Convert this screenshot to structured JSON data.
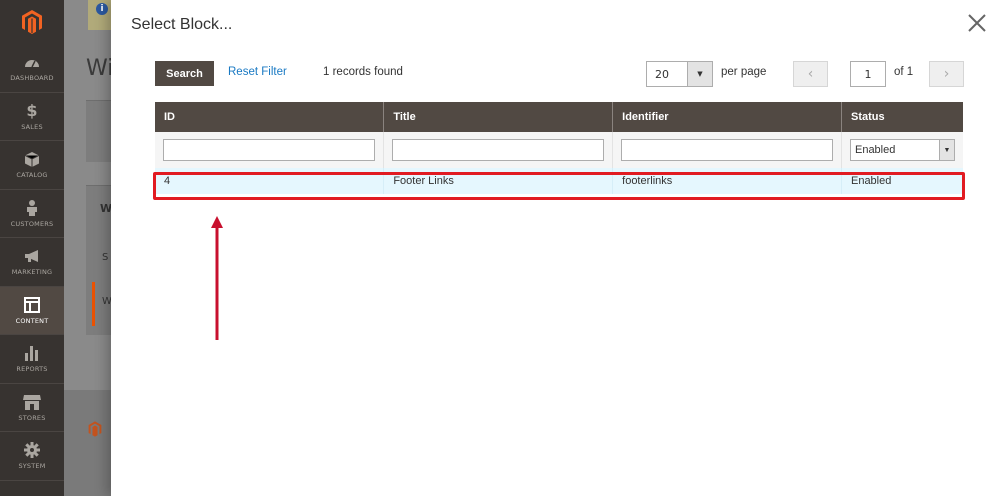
{
  "sidebar": {
    "items": [
      {
        "label": "Dashboard",
        "icon": "dashboard-icon"
      },
      {
        "label": "Sales",
        "icon": "dollar-icon"
      },
      {
        "label": "Catalog",
        "icon": "cube-icon"
      },
      {
        "label": "Customers",
        "icon": "person-icon"
      },
      {
        "label": "Marketing",
        "icon": "megaphone-icon"
      },
      {
        "label": "Content",
        "icon": "layout-icon"
      },
      {
        "label": "Reports",
        "icon": "bar-chart-icon"
      },
      {
        "label": "Stores",
        "icon": "store-icon"
      },
      {
        "label": "System",
        "icon": "gear-icon"
      }
    ]
  },
  "background": {
    "title_partial": "Wi",
    "box1_partial": "W",
    "box2_partial": "S",
    "box3_partial": "W"
  },
  "modal": {
    "title": "Select Block...",
    "toolbar": {
      "search_label": "Search",
      "reset_label": "Reset Filter",
      "records_text": "1 records found",
      "per_page_value": "20",
      "per_page_label": "per page",
      "current_page": "1",
      "total_pages_text": "of 1"
    },
    "grid": {
      "columns": [
        "ID",
        "Title",
        "Identifier",
        "Status"
      ],
      "status_filter_value": "Enabled",
      "rows": [
        {
          "id": "4",
          "title": "Footer Links",
          "identifier": "footerlinks",
          "status": "Enabled"
        }
      ]
    }
  },
  "colors": {
    "sidebar_bg": "#373330",
    "header_bg": "#514943",
    "link": "#1979c3",
    "highlight": "#e11b22",
    "row_bg": "#e5f7fe"
  }
}
